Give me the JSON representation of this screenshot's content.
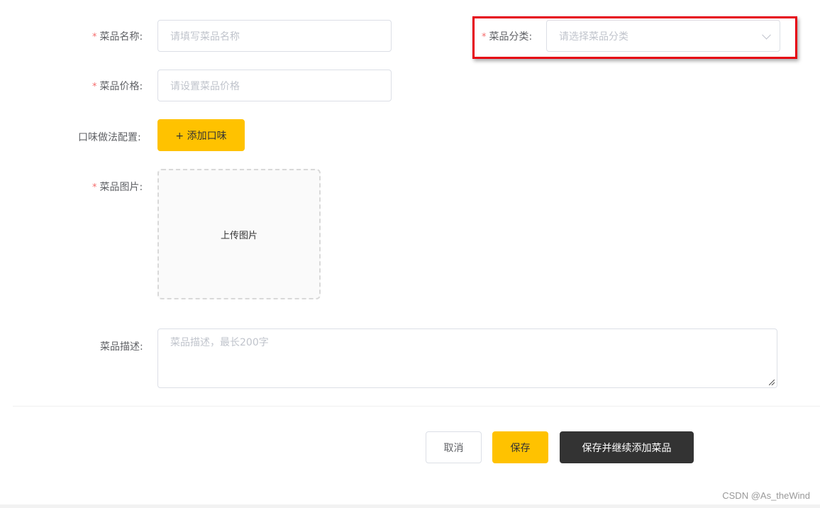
{
  "form": {
    "dish_name": {
      "required_mark": "*",
      "label": "菜品名称:",
      "placeholder": "请填写菜品名称",
      "value": ""
    },
    "dish_category": {
      "required_mark": "*",
      "label": "菜品分类:",
      "placeholder": "请选择菜品分类",
      "selected": ""
    },
    "dish_price": {
      "required_mark": "*",
      "label": "菜品价格:",
      "placeholder": "请设置菜品价格",
      "value": ""
    },
    "flavor_config": {
      "label": "口味做法配置:",
      "add_button": "+ 添加口味"
    },
    "dish_image": {
      "required_mark": "*",
      "label": "菜品图片:",
      "upload_text": "上传图片"
    },
    "dish_description": {
      "label": "菜品描述:",
      "placeholder": "菜品描述，最长200字",
      "value": ""
    }
  },
  "actions": {
    "cancel": "取消",
    "save": "保存",
    "save_and_continue": "保存并继续添加菜品"
  },
  "watermark": "CSDN @As_theWind",
  "colors": {
    "accent": "#ffc200",
    "dark_button": "#333333",
    "required": "#f56c6c",
    "highlight": "#e60012"
  }
}
